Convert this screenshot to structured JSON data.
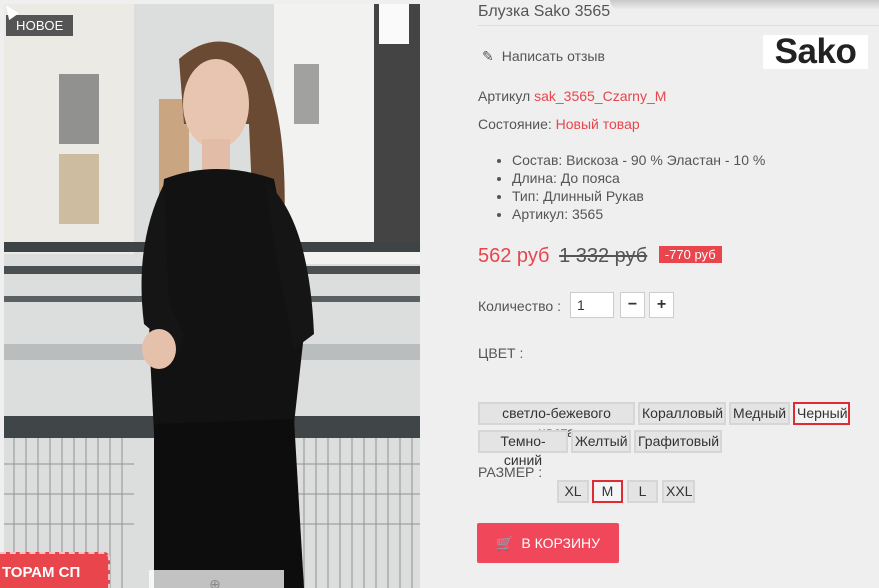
{
  "product": {
    "badge": "НОВОЕ",
    "banner": "ТОРАМ СП",
    "title": "Блузка Sako 3565",
    "review_label": "Написать отзыв",
    "brand_logo": "Sako",
    "sku_label": "Артикул",
    "sku_value": "sak_3565_Czarny_M",
    "condition_label": "Состояние:",
    "condition_value": "Новый товар",
    "features": [
      "Состав: Вискоза - 90 % Эластан - 10 %",
      "Длина: До пояса",
      "Тип: Длинный Рукав",
      "Артикул: 3565"
    ],
    "price_new": "562 руб",
    "price_old": "1 332 руб",
    "discount": "-770 руб",
    "quantity_label": "Количество :",
    "quantity_value": "1",
    "minus": "−",
    "plus": "+",
    "color_label": "ЦВЕТ :",
    "colors": [
      "светло-бежевого цвета",
      "Коралловый",
      "Медный",
      "Черный",
      "Темно-синий",
      "Желтый",
      "Графитовый"
    ],
    "selected_color": "Черный",
    "size_label": "РАЗМЕР :",
    "sizes": [
      "XL",
      "M",
      "L",
      "XXL"
    ],
    "selected_size": "M",
    "cart_label": "В КОРЗИНУ"
  },
  "icons": {
    "review": "pencil-icon",
    "cart": "cart-icon",
    "zoom": "zoom-icon"
  },
  "colors_theme": {
    "accent": "#e8454d",
    "button": "#f0475a",
    "selected_border": "#e02b35"
  }
}
